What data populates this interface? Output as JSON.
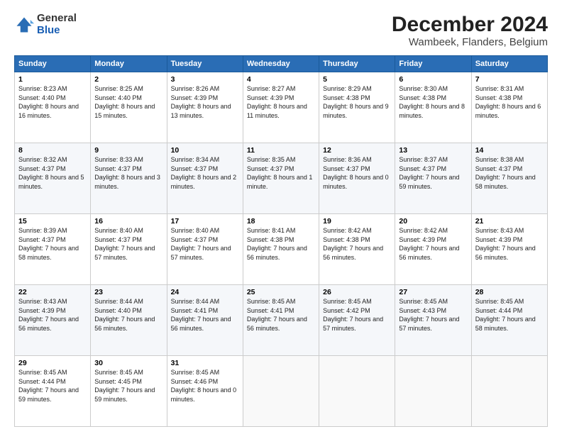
{
  "logo": {
    "general": "General",
    "blue": "Blue"
  },
  "header": {
    "title": "December 2024",
    "subtitle": "Wambeek, Flanders, Belgium"
  },
  "weekdays": [
    "Sunday",
    "Monday",
    "Tuesday",
    "Wednesday",
    "Thursday",
    "Friday",
    "Saturday"
  ],
  "weeks": [
    [
      {
        "day": "1",
        "info": "Sunrise: 8:23 AM\nSunset: 4:40 PM\nDaylight: 8 hours and 16 minutes."
      },
      {
        "day": "2",
        "info": "Sunrise: 8:25 AM\nSunset: 4:40 PM\nDaylight: 8 hours and 15 minutes."
      },
      {
        "day": "3",
        "info": "Sunrise: 8:26 AM\nSunset: 4:39 PM\nDaylight: 8 hours and 13 minutes."
      },
      {
        "day": "4",
        "info": "Sunrise: 8:27 AM\nSunset: 4:39 PM\nDaylight: 8 hours and 11 minutes."
      },
      {
        "day": "5",
        "info": "Sunrise: 8:29 AM\nSunset: 4:38 PM\nDaylight: 8 hours and 9 minutes."
      },
      {
        "day": "6",
        "info": "Sunrise: 8:30 AM\nSunset: 4:38 PM\nDaylight: 8 hours and 8 minutes."
      },
      {
        "day": "7",
        "info": "Sunrise: 8:31 AM\nSunset: 4:38 PM\nDaylight: 8 hours and 6 minutes."
      }
    ],
    [
      {
        "day": "8",
        "info": "Sunrise: 8:32 AM\nSunset: 4:37 PM\nDaylight: 8 hours and 5 minutes."
      },
      {
        "day": "9",
        "info": "Sunrise: 8:33 AM\nSunset: 4:37 PM\nDaylight: 8 hours and 3 minutes."
      },
      {
        "day": "10",
        "info": "Sunrise: 8:34 AM\nSunset: 4:37 PM\nDaylight: 8 hours and 2 minutes."
      },
      {
        "day": "11",
        "info": "Sunrise: 8:35 AM\nSunset: 4:37 PM\nDaylight: 8 hours and 1 minute."
      },
      {
        "day": "12",
        "info": "Sunrise: 8:36 AM\nSunset: 4:37 PM\nDaylight: 8 hours and 0 minutes."
      },
      {
        "day": "13",
        "info": "Sunrise: 8:37 AM\nSunset: 4:37 PM\nDaylight: 7 hours and 59 minutes."
      },
      {
        "day": "14",
        "info": "Sunrise: 8:38 AM\nSunset: 4:37 PM\nDaylight: 7 hours and 58 minutes."
      }
    ],
    [
      {
        "day": "15",
        "info": "Sunrise: 8:39 AM\nSunset: 4:37 PM\nDaylight: 7 hours and 58 minutes."
      },
      {
        "day": "16",
        "info": "Sunrise: 8:40 AM\nSunset: 4:37 PM\nDaylight: 7 hours and 57 minutes."
      },
      {
        "day": "17",
        "info": "Sunrise: 8:40 AM\nSunset: 4:37 PM\nDaylight: 7 hours and 57 minutes."
      },
      {
        "day": "18",
        "info": "Sunrise: 8:41 AM\nSunset: 4:38 PM\nDaylight: 7 hours and 56 minutes."
      },
      {
        "day": "19",
        "info": "Sunrise: 8:42 AM\nSunset: 4:38 PM\nDaylight: 7 hours and 56 minutes."
      },
      {
        "day": "20",
        "info": "Sunrise: 8:42 AM\nSunset: 4:39 PM\nDaylight: 7 hours and 56 minutes."
      },
      {
        "day": "21",
        "info": "Sunrise: 8:43 AM\nSunset: 4:39 PM\nDaylight: 7 hours and 56 minutes."
      }
    ],
    [
      {
        "day": "22",
        "info": "Sunrise: 8:43 AM\nSunset: 4:39 PM\nDaylight: 7 hours and 56 minutes."
      },
      {
        "day": "23",
        "info": "Sunrise: 8:44 AM\nSunset: 4:40 PM\nDaylight: 7 hours and 56 minutes."
      },
      {
        "day": "24",
        "info": "Sunrise: 8:44 AM\nSunset: 4:41 PM\nDaylight: 7 hours and 56 minutes."
      },
      {
        "day": "25",
        "info": "Sunrise: 8:45 AM\nSunset: 4:41 PM\nDaylight: 7 hours and 56 minutes."
      },
      {
        "day": "26",
        "info": "Sunrise: 8:45 AM\nSunset: 4:42 PM\nDaylight: 7 hours and 57 minutes."
      },
      {
        "day": "27",
        "info": "Sunrise: 8:45 AM\nSunset: 4:43 PM\nDaylight: 7 hours and 57 minutes."
      },
      {
        "day": "28",
        "info": "Sunrise: 8:45 AM\nSunset: 4:44 PM\nDaylight: 7 hours and 58 minutes."
      }
    ],
    [
      {
        "day": "29",
        "info": "Sunrise: 8:45 AM\nSunset: 4:44 PM\nDaylight: 7 hours and 59 minutes."
      },
      {
        "day": "30",
        "info": "Sunrise: 8:45 AM\nSunset: 4:45 PM\nDaylight: 7 hours and 59 minutes."
      },
      {
        "day": "31",
        "info": "Sunrise: 8:45 AM\nSunset: 4:46 PM\nDaylight: 8 hours and 0 minutes."
      },
      null,
      null,
      null,
      null
    ]
  ]
}
